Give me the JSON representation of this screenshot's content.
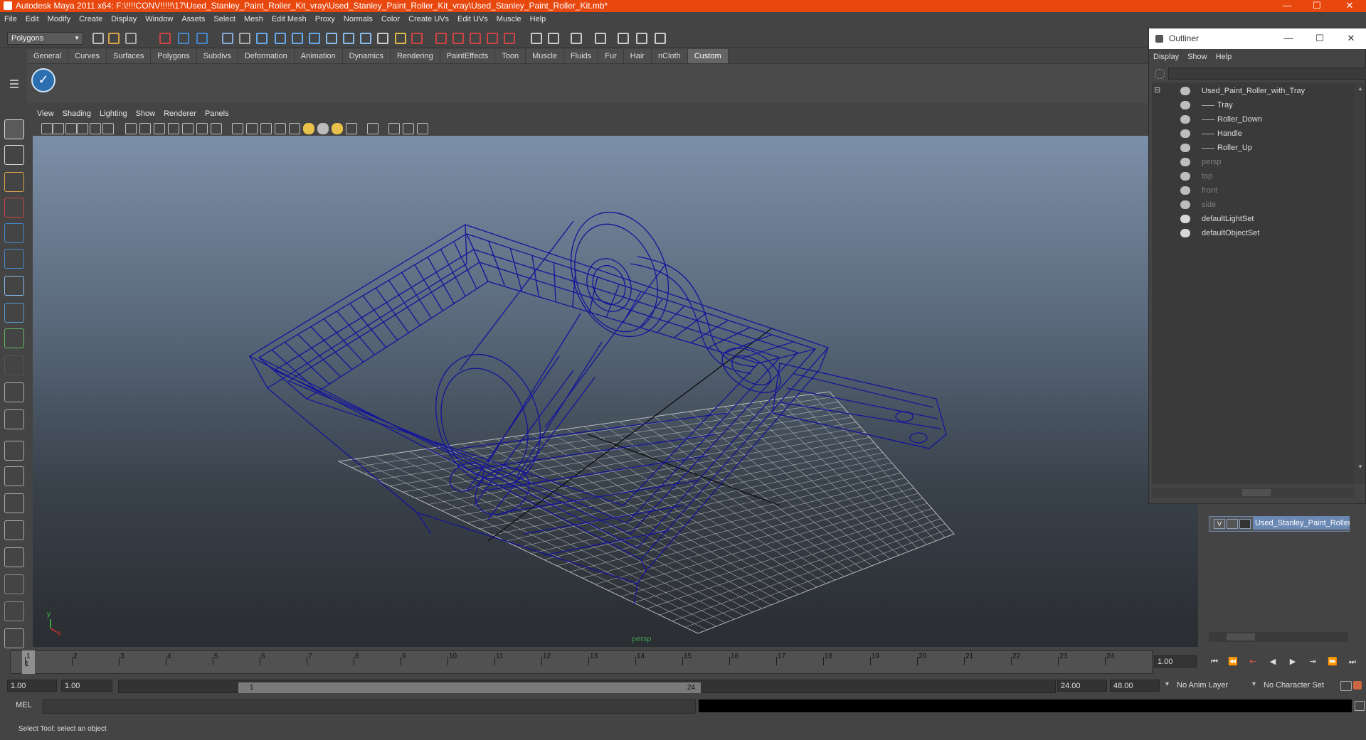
{
  "window": {
    "title": "Autodesk Maya 2011 x64: F:\\!!!!CONV!!!!!\\17\\Used_Stanley_Paint_Roller_Kit_vray\\Used_Stanley_Paint_Roller_Kit_vray\\Used_Stanley_Paint_Roller_Kit.mb*",
    "minimize": "—",
    "maximize": "☐",
    "close": "✕"
  },
  "menus": [
    "File",
    "Edit",
    "Modify",
    "Create",
    "Display",
    "Window",
    "Assets",
    "Select",
    "Mesh",
    "Edit Mesh",
    "Proxy",
    "Normals",
    "Color",
    "Create UVs",
    "Edit UVs",
    "Muscle",
    "Help"
  ],
  "toolbar": {
    "mode": "Polygons"
  },
  "shelf": {
    "tabs": [
      "General",
      "Curves",
      "Surfaces",
      "Polygons",
      "Subdivs",
      "Deformation",
      "Animation",
      "Dynamics",
      "Rendering",
      "PaintEffects",
      "Toon",
      "Muscle",
      "Fluids",
      "Fur",
      "Hair",
      "nCloth",
      "Custom"
    ],
    "active": "Custom",
    "check_icon": "✓"
  },
  "viewport": {
    "menus": [
      "View",
      "Shading",
      "Lighting",
      "Show",
      "Renderer",
      "Panels"
    ],
    "camera": "persp",
    "axis_y": "y",
    "axis_x": "x"
  },
  "outliner": {
    "title": "Outliner",
    "minimize": "—",
    "maximize": "☐",
    "close": "✕",
    "menus": [
      "Display",
      "Show",
      "Help"
    ],
    "collapse": "⊟",
    "items": [
      {
        "label": "Used_Paint_Roller_with_Tray",
        "indent": 0,
        "dim": false
      },
      {
        "label": "Tray",
        "indent": 1,
        "dim": false
      },
      {
        "label": "Roller_Down",
        "indent": 1,
        "dim": false
      },
      {
        "label": "Handle",
        "indent": 1,
        "dim": false
      },
      {
        "label": "Roller_Up",
        "indent": 1,
        "dim": false
      },
      {
        "label": "persp",
        "indent": 0,
        "dim": true
      },
      {
        "label": "top",
        "indent": 0,
        "dim": true
      },
      {
        "label": "front",
        "indent": 0,
        "dim": true
      },
      {
        "label": "side",
        "indent": 0,
        "dim": true
      },
      {
        "label": "defaultLightSet",
        "indent": 0,
        "dim": false
      },
      {
        "label": "defaultObjectSet",
        "indent": 0,
        "dim": false
      }
    ]
  },
  "layer": {
    "visible": "V",
    "name": "Used_Stanley_Paint_Roller"
  },
  "timeline": {
    "ticks": [
      "1",
      "2",
      "3",
      "4",
      "5",
      "6",
      "7",
      "8",
      "9",
      "10",
      "11",
      "12",
      "13",
      "14",
      "15",
      "16",
      "17",
      "18",
      "19",
      "20",
      "21",
      "22",
      "23",
      "24"
    ],
    "current": "1",
    "frame_field": "1.00",
    "playback": [
      "⏮",
      "⏪",
      "⇤",
      "◀",
      "▶",
      "⇥",
      "⏩",
      "⏭"
    ]
  },
  "range": {
    "start": "1.00",
    "inner_start": "1.00",
    "handle_left": "1",
    "handle_right": "24",
    "end": "24.00",
    "outer_end": "48.00",
    "anim_layer": "No Anim Layer",
    "char_set": "No Character Set"
  },
  "command": {
    "lang": "MEL"
  },
  "help": {
    "text": "Select Tool: select an object"
  }
}
